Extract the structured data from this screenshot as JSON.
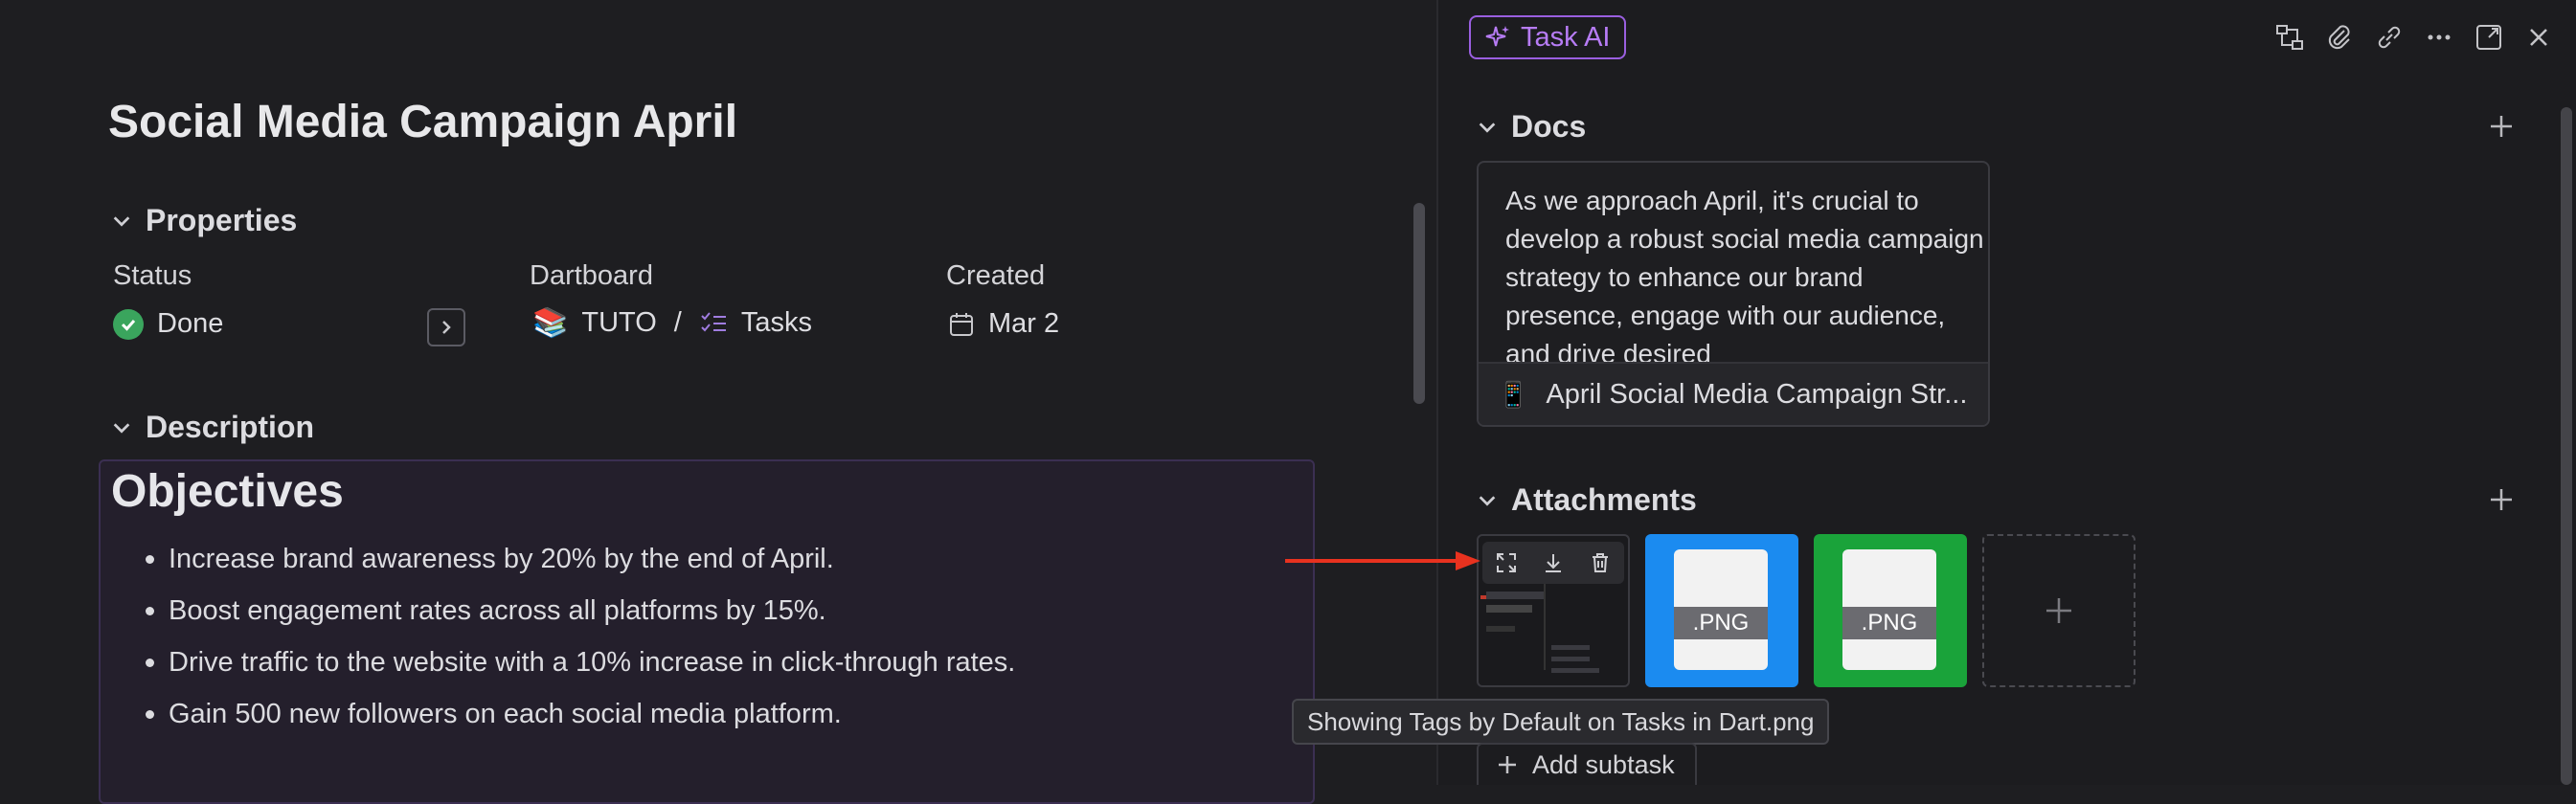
{
  "task": {
    "title": "Social Media Campaign April"
  },
  "properties": {
    "heading": "Properties",
    "status": {
      "label": "Status",
      "value": "Done"
    },
    "dartboard": {
      "label": "Dartboard",
      "board": "TUTO",
      "separator": "/",
      "list": "Tasks"
    },
    "created": {
      "label": "Created",
      "value": "Mar 2"
    }
  },
  "description": {
    "heading": "Description",
    "objectives_title": "Objectives",
    "bullets": [
      "Increase brand awareness by 20% by the end of April.",
      "Boost engagement rates across all platforms by 15%.",
      "Drive traffic to the website with a 10% increase in click-through rates.",
      "Gain 500 new followers on each social media platform."
    ]
  },
  "panel": {
    "task_ai_label": "Task AI",
    "docs": {
      "heading": "Docs",
      "preview_text": "As we approach April, it's crucial to develop a robust social media campaign strategy to enhance our brand presence, engage with our audience, and drive desired",
      "doc_title": "April Social Media Campaign Str..."
    },
    "attachments": {
      "heading": "Attachments",
      "items": [
        {
          "type": "image",
          "name": "Showing Tags by Default on Tasks in Dart.png"
        },
        {
          "type": "png",
          "label": ".PNG",
          "color": "#1b8bf0"
        },
        {
          "type": "png",
          "label": ".PNG",
          "color": "#1aa33a"
        }
      ],
      "tooltip": "Showing Tags by Default on Tasks in Dart.png"
    },
    "add_subtask_label": "Add subtask"
  },
  "colors": {
    "accent": "#9a5fe0",
    "done": "#3aa55d",
    "annotation_arrow": "#e8321f"
  }
}
